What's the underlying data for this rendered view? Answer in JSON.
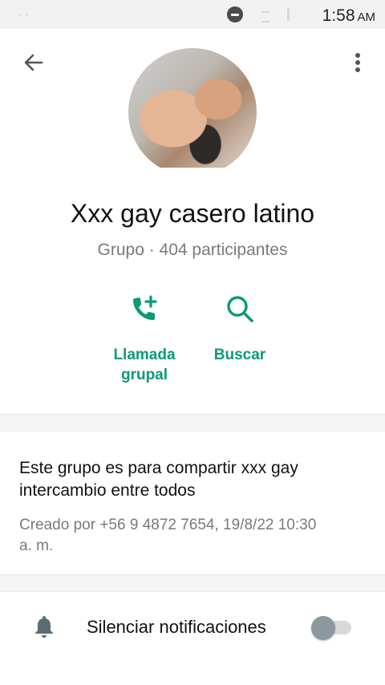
{
  "status_bar": {
    "time": "1:58",
    "ampm": "AM"
  },
  "header": {
    "back_icon": "arrow-back-icon",
    "menu_icon": "more-vertical-icon"
  },
  "group": {
    "name": "Xxx gay casero latino",
    "meta": "Grupo · 404 participantes"
  },
  "actions": [
    {
      "label_line1": "Llamada",
      "label_line2": "grupal",
      "icon": "add-call-icon"
    },
    {
      "label": "Buscar",
      "icon": "search-icon"
    }
  ],
  "info": {
    "description_line1": "Este grupo es para compartir xxx gay",
    "description_line2": "intercambio entre todos",
    "created_line1": "Creado por +56 9 4872 7654, 19/8/22 10:30",
    "created_line2": "a. m."
  },
  "settings": {
    "mute_label": "Silenciar notificaciones",
    "mute_enabled": false
  },
  "colors": {
    "accent": "#0a9a77",
    "muted_text": "#7a7a7a"
  }
}
